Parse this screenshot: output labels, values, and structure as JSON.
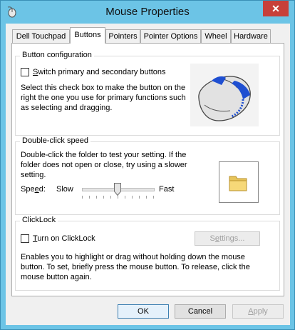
{
  "window": {
    "title": "Mouse Properties",
    "close_glyph": "✕"
  },
  "tabs": [
    {
      "label": "Dell Touchpad",
      "active": false
    },
    {
      "label": "Buttons",
      "active": true
    },
    {
      "label": "Pointers",
      "active": false
    },
    {
      "label": "Pointer Options",
      "active": false
    },
    {
      "label": "Wheel",
      "active": false
    },
    {
      "label": "Hardware",
      "active": false
    }
  ],
  "button_config": {
    "legend": "Button configuration",
    "checkbox_label": "Switch primary and secondary buttons",
    "checked": false,
    "description": [
      "Select this check box to make the button on the",
      "right the one you use for primary functions such",
      "as selecting and dragging."
    ]
  },
  "double_click": {
    "legend": "Double-click speed",
    "description": [
      "Double-click the folder to test your setting. If the",
      "folder does not open or close, try using a slower",
      "setting."
    ],
    "speed_label": "Speed:",
    "slow_label": "Slow",
    "fast_label": "Fast",
    "speed_fraction": 0.5
  },
  "clicklock": {
    "legend": "ClickLock",
    "checkbox_label": "Turn on ClickLock",
    "checked": false,
    "settings_label": "Settings...",
    "description": [
      "Enables you to highlight or drag without holding down the mouse",
      "button. To set, briefly press the mouse button. To release, click the",
      "mouse button again."
    ]
  },
  "footer": {
    "ok": "OK",
    "cancel": "Cancel",
    "apply": "Apply"
  },
  "icons": {
    "app": "mouse-icon",
    "preview": "mouse-illustration",
    "folder": "folder-icon"
  },
  "colors": {
    "frame": "#6cc4e6",
    "close": "#c7403a",
    "mouse_accent": "#1f4fd1"
  }
}
